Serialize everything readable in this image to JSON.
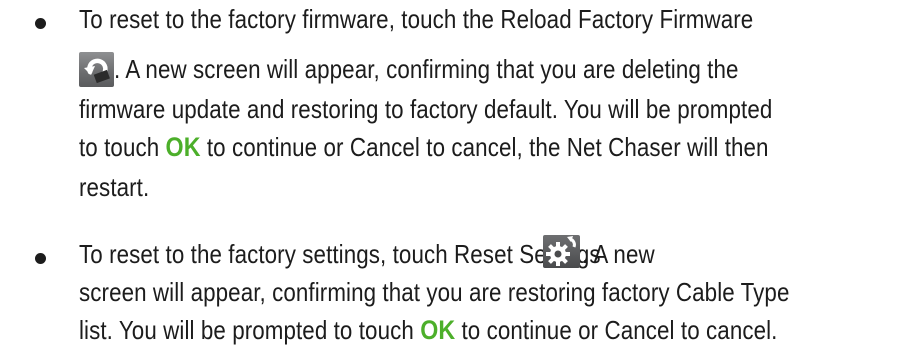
{
  "items": [
    {
      "lines": [
        "To reset to the factory firmware, touch the Reload Factory Firmware",
        ". A new screen will appear, confirming that you are deleting the",
        "firmware update and restoring to factory default. You will be prompted",
        "to touch",
        "OK",
        "to continue or Cancel to cancel, the Net Chaser will then",
        "restart."
      ],
      "icon": "reload-factory-firmware-icon"
    },
    {
      "lines": [
        "To reset to the factory settings, touch Reset Settings",
        ". A new",
        "screen will appear, confirming that you are restoring factory Cable Type",
        "list. You will be prompted to touch",
        "OK",
        "to continue or Cancel to cancel."
      ],
      "icon": "reset-settings-icon"
    }
  ],
  "colors": {
    "ok_green": "#4caf2a",
    "text": "#1c1c1c"
  }
}
